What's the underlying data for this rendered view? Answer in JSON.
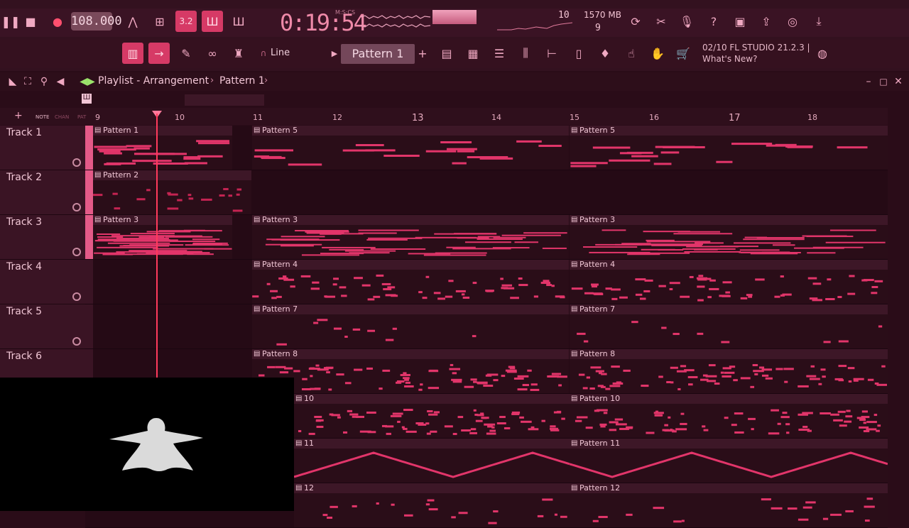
{
  "toolbar": {
    "tempo": "108.000",
    "time": "0:19:54",
    "time_label": "M:S:CS",
    "cpu": "10",
    "memory": "1570 MB",
    "polyphony": "9",
    "snap": "Line",
    "pattern": "Pattern 1",
    "news_line1": "02/10  FL STUDIO 21.2.3 |",
    "news_line2": "What's New?",
    "pattern_add": "+",
    "icons": [
      "pause-icon",
      "stop-icon",
      "record-icon",
      "metronome-icon",
      "wait-icon",
      "countdown-icon",
      "step-icon",
      "blend-icon",
      "refresh-icon",
      "cut-icon",
      "mic-icon",
      "help-icon",
      "save-icon",
      "render-icon",
      "chat-icon",
      "download-icon"
    ]
  },
  "playlist": {
    "title": "Playlist - Arrangement",
    "breadcrumb": "Pattern 1",
    "ruler_tabs": [
      "NOTE",
      "CHAN",
      "PAT"
    ],
    "ruler": [
      "9",
      "10",
      "11",
      "12",
      "13",
      "14",
      "15",
      "16",
      "17",
      "18"
    ]
  },
  "tracks": [
    "Track 1",
    "Track 2",
    "Track 3",
    "Track 4",
    "Track 5",
    "Track 6"
  ],
  "clips": [
    {
      "track": 0,
      "label": "Pattern 1"
    },
    {
      "track": 0,
      "label": "Pattern 5"
    },
    {
      "track": 0,
      "label": "Pattern 5"
    },
    {
      "track": 1,
      "label": "Pattern 2"
    },
    {
      "track": 2,
      "label": "Pattern 3"
    },
    {
      "track": 2,
      "label": "Pattern 3"
    },
    {
      "track": 2,
      "label": "Pattern 3"
    },
    {
      "track": 3,
      "label": "Pattern 4"
    },
    {
      "track": 3,
      "label": "Pattern 4"
    },
    {
      "track": 4,
      "label": "Pattern 7"
    },
    {
      "track": 4,
      "label": "Pattern 7"
    },
    {
      "track": 5,
      "label": "Pattern 8"
    },
    {
      "track": 5,
      "label": "Pattern 8"
    },
    {
      "track": 6,
      "label": "10"
    },
    {
      "track": 6,
      "label": "Pattern 10"
    },
    {
      "track": 7,
      "label": "11"
    },
    {
      "track": 7,
      "label": "Pattern 11"
    },
    {
      "track": 8,
      "label": "12"
    },
    {
      "track": 8,
      "label": "Pattern 12"
    }
  ]
}
